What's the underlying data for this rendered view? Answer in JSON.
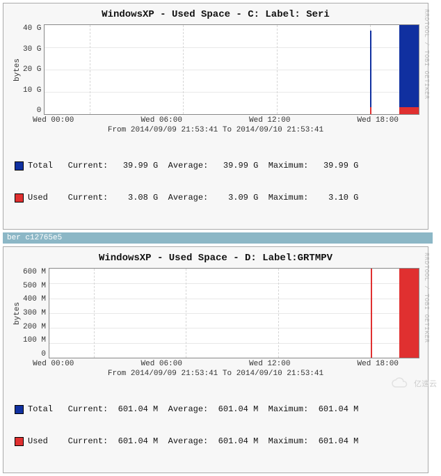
{
  "panels": [
    {
      "title": "WindowsXP - Used Space - C: Label:  Seri",
      "ylabel": "bytes",
      "yticks": [
        "40 G",
        "30 G",
        "20 G",
        "10 G",
        "0"
      ],
      "xticks": [
        "Wed 00:00",
        "Wed 06:00",
        "Wed 12:00",
        "Wed 18:00"
      ],
      "time_caption": "From 2014/09/09 21:53:41 To 2014/09/10 21:53:41",
      "legend": [
        {
          "swatch": "#1030a0",
          "label": "Total",
          "current": "39.99 G",
          "average": "39.99 G",
          "maximum": "39.99 G"
        },
        {
          "swatch": "#e03030",
          "label": "Used",
          "current": "3.08 G",
          "average": "3.09 G",
          "maximum": "3.10 G"
        }
      ]
    },
    {
      "title": "WindowsXP - Used Space - D: Label:GRTMPV",
      "ylabel": "bytes",
      "yticks": [
        "600 M",
        "500 M",
        "400 M",
        "300 M",
        "200 M",
        "100 M",
        "0"
      ],
      "xticks": [
        "Wed 00:00",
        "Wed 06:00",
        "Wed 12:00",
        "Wed 18:00"
      ],
      "time_caption": "From 2014/09/09 21:53:41 To 2014/09/10 21:53:41",
      "legend": [
        {
          "swatch": "#1030a0",
          "label": "Total",
          "current": "601.04 M",
          "average": "601.04 M",
          "maximum": "601.04 M"
        },
        {
          "swatch": "#e03030",
          "label": "Used",
          "current": "601.04 M",
          "average": "601.04 M",
          "maximum": "601.04 M"
        }
      ]
    }
  ],
  "divider_text": "ber c12765e5",
  "side_attribution": "RRDTOOL / TOBI OETIKER",
  "watermark": "亿速云",
  "colors": {
    "total": "#1030a0",
    "used": "#e03030"
  },
  "chart_data": [
    {
      "type": "area",
      "title": "WindowsXP - Used Space - C: Label:  Seri",
      "xlabel": "",
      "ylabel": "bytes",
      "x_range": [
        "2014-09-09 21:53:41",
        "2014-09-10 21:53:41"
      ],
      "ylim": [
        0,
        40
      ],
      "y_unit": "G",
      "x": [
        "2014-09-10 19:00",
        "2014-09-10 21:53"
      ],
      "series": [
        {
          "name": "Total",
          "color": "#1030a0",
          "values": [
            39.99,
            39.99
          ]
        },
        {
          "name": "Used",
          "color": "#e03030",
          "values": [
            3.08,
            3.1
          ]
        }
      ],
      "note": "Data visible only as narrow stacked-area slivers near end of range; earlier timestamps show no data."
    },
    {
      "type": "area",
      "title": "WindowsXP - Used Space - D: Label:GRTMPV",
      "xlabel": "",
      "ylabel": "bytes",
      "x_range": [
        "2014-09-09 21:53:41",
        "2014-09-10 21:53:41"
      ],
      "ylim": [
        0,
        600
      ],
      "y_unit": "M",
      "x": [
        "2014-09-10 19:00",
        "2014-09-10 21:53"
      ],
      "series": [
        {
          "name": "Total",
          "color": "#1030a0",
          "values": [
            601.04,
            601.04
          ]
        },
        {
          "name": "Used",
          "color": "#e03030",
          "values": [
            601.04,
            601.04
          ]
        }
      ],
      "note": "Used equals Total so only red fill visible; narrow slivers near end of range."
    }
  ]
}
